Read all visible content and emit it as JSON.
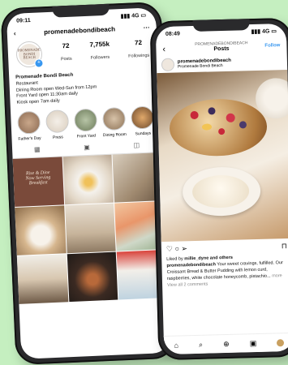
{
  "left": {
    "status": {
      "time": "09:11",
      "signal": "4G"
    },
    "header": {
      "username": "promenadebondibeach",
      "back_icon": "chevron-left-icon",
      "menu_icon": "more-icon"
    },
    "profile": {
      "avatar_text": "PROMENADE BONDI BEACH",
      "posts": "72",
      "posts_label": "Posts",
      "followers": "7,755k",
      "followers_label": "Followers",
      "followings": "72",
      "followings_label": "Followings"
    },
    "bio": {
      "name": "Promenade Bondi Beach",
      "line1": "Restaurant",
      "line2": "Dining Room open Wed-Sun from 12pm",
      "line3": "Front Yard open 11:30am daily",
      "line4": "Kiosk open 7am daily"
    },
    "highlights": [
      "Father's Day",
      "Press",
      "Front Yard",
      "Dining Room",
      "Sundays"
    ],
    "grid_text": {
      "line1": "Rise & Dine",
      "line2": "Now Serving",
      "line3": "Breakfast"
    }
  },
  "right": {
    "status": {
      "time": "08:49",
      "signal": "4G"
    },
    "header": {
      "account": "PROMENADEBONDIBEACH",
      "title": "Posts",
      "follow": "Follow"
    },
    "post": {
      "username": "promenadebondibeach",
      "location": "Promenade Bondi Beach",
      "liked_prefix": "Liked by",
      "liked_user": "millie_dyne",
      "liked_suffix": "and others",
      "caption_user": "promenadebondibeach",
      "caption_text": "Your sweet cravings, fulfilled. Our Croissant Bread & Butter Pudding with lemon curd, raspberries, white chocolate honeycomb, pistachio...",
      "more": "more",
      "comments": "View all 2 comments"
    }
  },
  "colors": {
    "background": "#c5efc0",
    "follow": "#3897f0"
  }
}
